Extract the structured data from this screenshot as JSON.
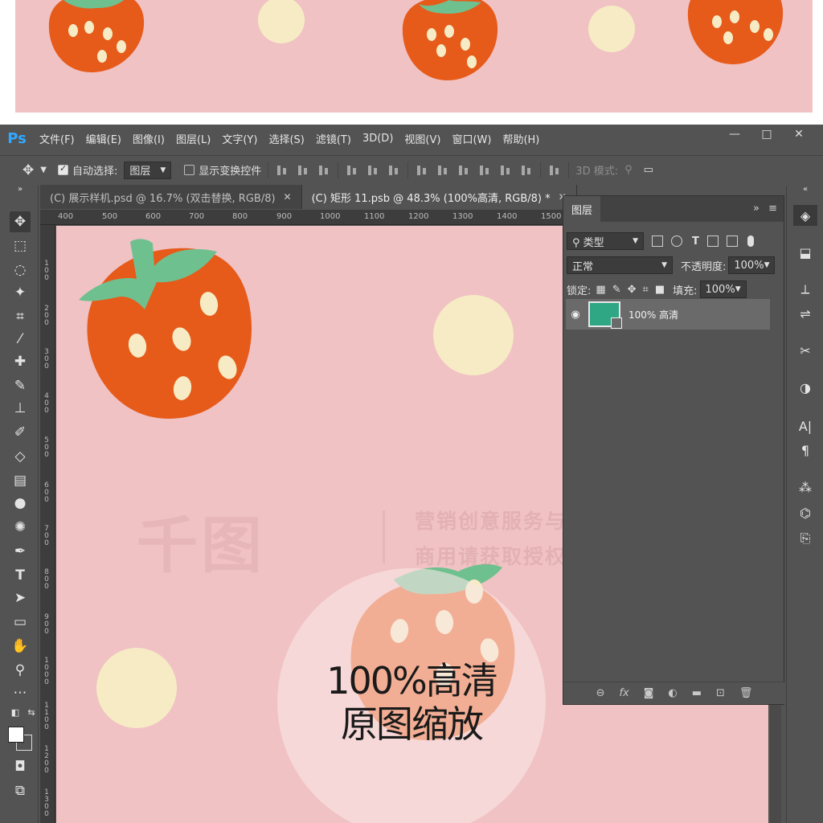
{
  "preview": {
    "strawberries": [
      {
        "name": "preview-strawberry-1"
      },
      {
        "name": "preview-strawberry-2"
      },
      {
        "name": "preview-strawberry-3"
      }
    ]
  },
  "app": {
    "logo": "Ps",
    "menus": [
      "文件(F)",
      "编辑(E)",
      "图像(I)",
      "图层(L)",
      "文字(Y)",
      "选择(S)",
      "滤镜(T)",
      "3D(D)",
      "视图(V)",
      "窗口(W)",
      "帮助(H)"
    ],
    "window_controls": [
      "—",
      "□",
      "✕"
    ]
  },
  "options": {
    "auto_select_label": "自动选择:",
    "auto_select_value": "图层",
    "show_transform_label": "显示变换控件",
    "mode_3d_label": "3D 模式:"
  },
  "tabs": [
    {
      "label": "(C) 展示样机.psd @ 16.7% (双击替换, RGB/8)",
      "close": "✕"
    },
    {
      "label": "(C) 矩形 11.psb @ 48.3% (100%高清, RGB/8) *",
      "close": "✕"
    }
  ],
  "ruler": {
    "labels": [
      "400",
      "500",
      "600",
      "700",
      "800",
      "900",
      "1000",
      "1100",
      "1200",
      "1300",
      "1400",
      "1500"
    ],
    "vlabels": [
      "100",
      "200",
      "300",
      "400",
      "500",
      "600",
      "700",
      "800",
      "900",
      "1000",
      "1100",
      "1200",
      "1300"
    ]
  },
  "canvas": {
    "zoom_line1": "100%高清",
    "zoom_line2": "原图缩放",
    "watermark_logo": "千图",
    "watermark_line1": "营销创意服务与协作平台",
    "watermark_line2": "商用请获取授权"
  },
  "layers": {
    "title": "图层",
    "filter_kind": "类型",
    "blend_mode": "正常",
    "opacity_label": "不透明度:",
    "opacity_value": "100%",
    "lock_label": "锁定:",
    "fill_label": "填充:",
    "fill_value": "100%",
    "items": [
      {
        "name": "100% 高清",
        "visible": true,
        "thumb_color": "#2fa684"
      }
    ]
  },
  "colors": {
    "bg_pink": "#f0c2c4",
    "strawberry_red": "#e65a1a",
    "leaf_green": "#6fc08f",
    "seed_cream": "#f6ebc4",
    "ps_blue": "#31a8ff"
  }
}
